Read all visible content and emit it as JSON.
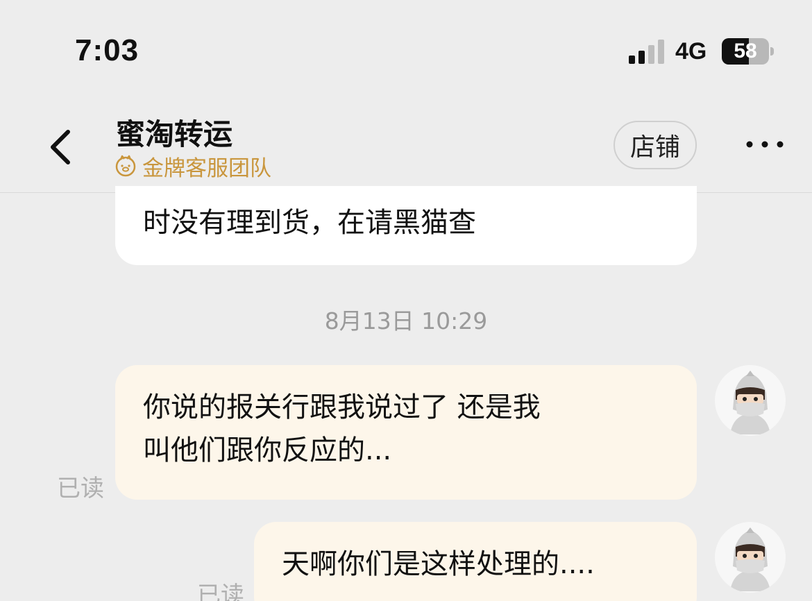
{
  "status_bar": {
    "time": "7:03",
    "network": "4G",
    "battery": "58",
    "battery_level_percent": 58,
    "signal_bars_active": 2,
    "signal_bars_total": 4
  },
  "header": {
    "shop_name": "蜜淘转运",
    "badge": "金牌客服团队",
    "badge_color": "#c9963d",
    "store_button": "店铺",
    "icons": [
      "chevron-left-icon",
      "piggy-badge-icon",
      "more-dots-icon"
    ]
  },
  "messages": {
    "partial_message": "时没有理到货，在请黑猫查",
    "timestamp": "8月13日 10:29",
    "outgoing": [
      {
        "lines": [
          "你说的报关行跟我说过了 还是我",
          "叫他们跟你反应的..."
        ],
        "read_status": "已读"
      },
      {
        "lines": [
          "天啊你们是这样处理的...."
        ],
        "read_status": "已读"
      }
    ],
    "bubble_color_incoming": "#ffffff",
    "bubble_color_outgoing": "#fdf6ea"
  }
}
